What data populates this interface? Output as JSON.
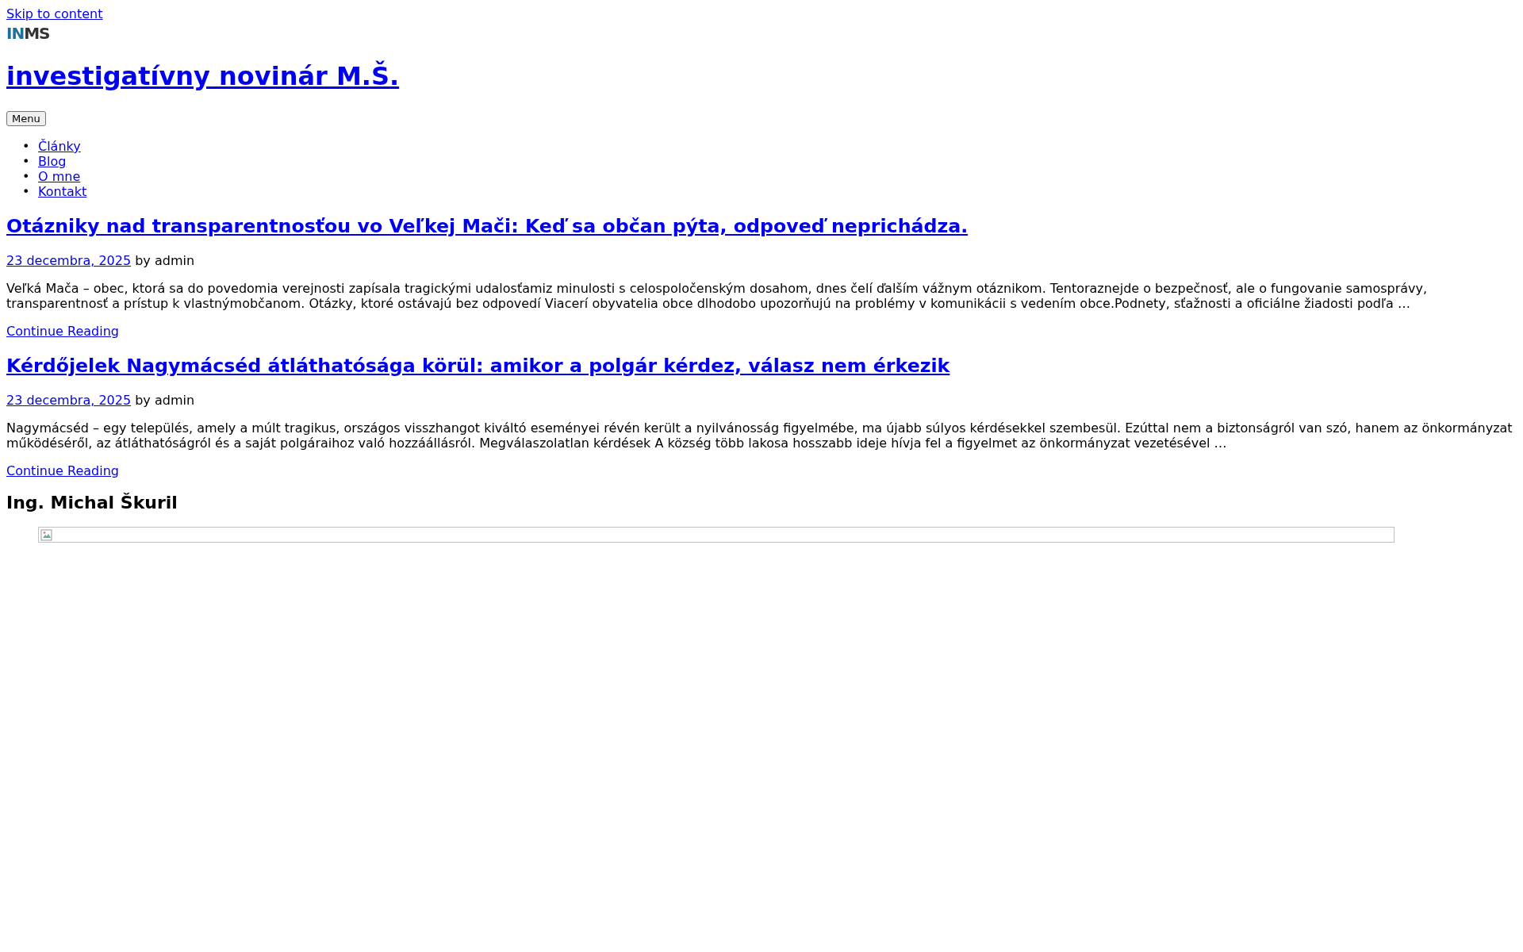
{
  "skip_link": "Skip to content",
  "logo": {
    "part_1": "IN",
    "part_2": "MS"
  },
  "site_title": "investigatívny novinár M.Š.",
  "menu_button": "Menu",
  "nav": [
    {
      "bullet": "•",
      "label": "Články"
    },
    {
      "bullet": "•",
      "label": "Blog"
    },
    {
      "bullet": "•",
      "label": "O mne"
    },
    {
      "bullet": "•",
      "label": "Kontakt"
    }
  ],
  "posts": [
    {
      "title": "Otázniky nad transparentnosťou vo Veľkej Mači: Keď sa občan pýta, odpoveď neprichádza.",
      "date": "23 decembra, 2025",
      "by": "by admin",
      "excerpt": "Veľká Mača – obec, ktorá sa do povedomia verejnosti zapísala tragickými udalosťamiz minulosti s celospoločenským dosahom, dnes čelí ďalším vážnym otáznikom. Tentoraznejde o bezpečnosť, ale o fungovanie samosprávy, transparentnosť a prístup k vlastnýmobčanom. Otázky, ktoré ostávajú bez odpovedí Viacerí obyvatelia obce dlhodobo upozorňujú na problémy v komunikácii s vedením obce.Podnety, sťažnosti a oficiálne žiadosti podľa …",
      "more": "Continue Reading"
    },
    {
      "title": "Kérdőjelek Nagymácséd átláthatósága körül: amikor a polgár kérdez, válasz nem érkezik",
      "date": "23 decembra, 2025",
      "by": "by admin",
      "excerpt": "Nagymácséd – egy település, amely a múlt tragikus, országos visszhangot kiváltó eseményei révén került a nyilvánosság figyelmébe, ma újabb súlyos kérdésekkel szembesül. Ezúttal nem a biztonságról van szó, hanem az önkormányzat működéséről, az átláthatóságról és a saját polgáraihoz való hozzáállásról. Megválaszolatlan kérdések A község több lakosa hosszabb ideje hívja fel a figyelmet az önkormányzat vezetésével …",
      "more": "Continue Reading"
    }
  ],
  "widget_title": "Ing. Michal Škuril",
  "widget_image": {
    "kind": "broken-image"
  }
}
